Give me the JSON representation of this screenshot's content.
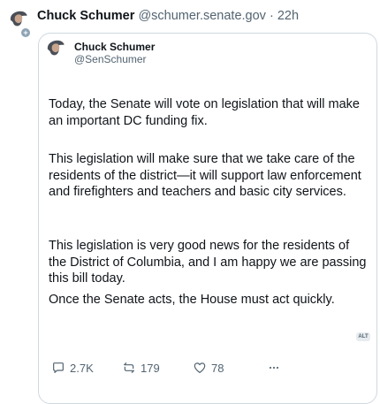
{
  "tweet": {
    "author_name": "Chuck Schumer",
    "author_handle": "@schumer.senate.gov",
    "separator": "·",
    "time": "22h"
  },
  "quoted": {
    "name": "Chuck Schumer",
    "handle": "@SenSchumer",
    "paragraphs": [
      "Today, the Senate will vote on legislation that will make an important DC funding fix.",
      "This legislation will make sure that we take care of the residents of the district—it will support law enforcement and firefighters and teachers and basic city services.",
      "This legislation is very good news for the residents of the District of Columbia, and I am happy we are passing this bill today.",
      "Once the Senate acts, the House must act quickly."
    ],
    "alt_badge": "ALT"
  },
  "actions": {
    "reply_count": "2.7K",
    "retweet_count": "179",
    "like_count": "78",
    "reply_icon": "reply-icon",
    "retweet_icon": "retweet-icon",
    "like_icon": "heart-icon",
    "more_icon": "more-icon"
  },
  "colors": {
    "text": "#0f1419",
    "muted": "#536471",
    "border": "#cfd9de"
  }
}
